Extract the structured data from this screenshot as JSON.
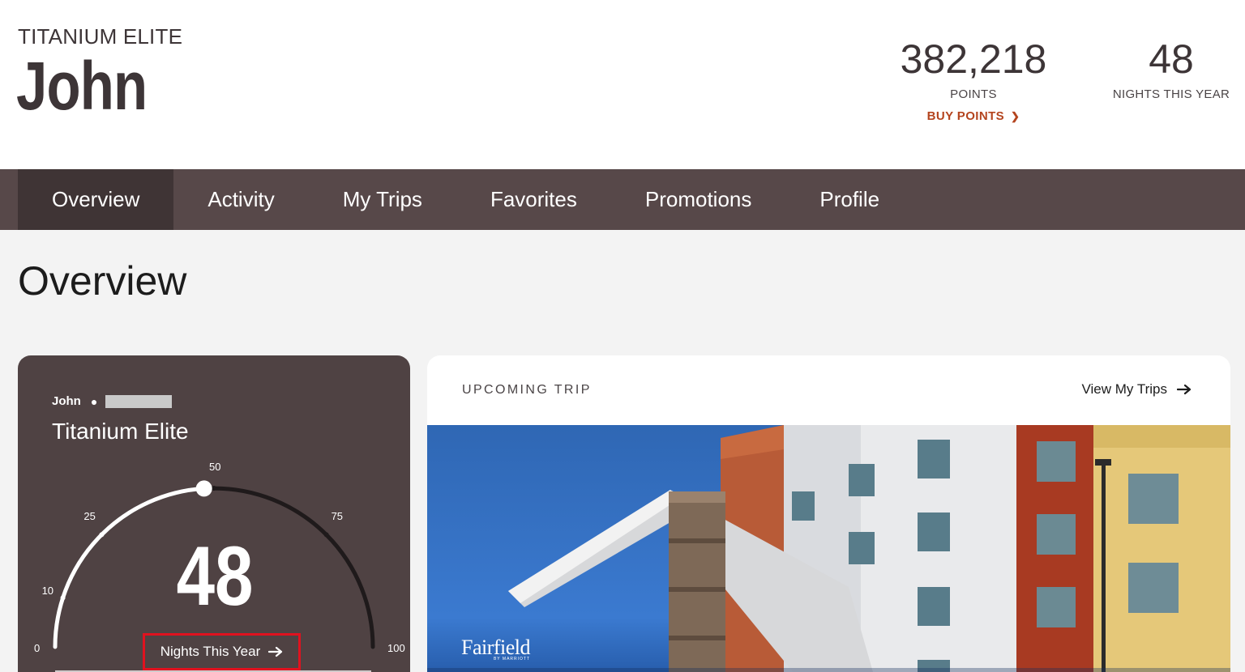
{
  "header": {
    "tier": "TITANIUM ELITE",
    "name": "John",
    "points_value": "382,218",
    "points_label": "POINTS",
    "buy_points": "BUY POINTS",
    "nights_value": "48",
    "nights_label": "NIGHTS THIS YEAR"
  },
  "nav": {
    "tabs": [
      {
        "label": "Overview",
        "active": true
      },
      {
        "label": "Activity"
      },
      {
        "label": "My Trips"
      },
      {
        "label": "Favorites"
      },
      {
        "label": "Promotions"
      },
      {
        "label": "Profile"
      }
    ]
  },
  "page": {
    "title": "Overview"
  },
  "status_card": {
    "member_name": "John",
    "tier": "Titanium Elite",
    "nights": "48",
    "nights_progress": 48,
    "gauge_max": 100,
    "ticks": [
      "0",
      "10",
      "25",
      "50",
      "75",
      "100"
    ],
    "link_label": "Nights This Year"
  },
  "trip_card": {
    "header": "UPCOMING TRIP",
    "link_label": "View My Trips",
    "brand": "Fairfield",
    "brand_sub": "BY MARRIOTT"
  },
  "icons": {
    "buy_points_chevron": "chevron-right-icon",
    "nights_arrow": "arrow-right-icon",
    "trips_arrow": "arrow-right-icon"
  },
  "colors": {
    "nav_bg": "#574849",
    "nav_active": "#3f3435",
    "card_bg": "#4f4243",
    "accent_orange": "#b4441e",
    "highlight_red": "#e0121f"
  }
}
